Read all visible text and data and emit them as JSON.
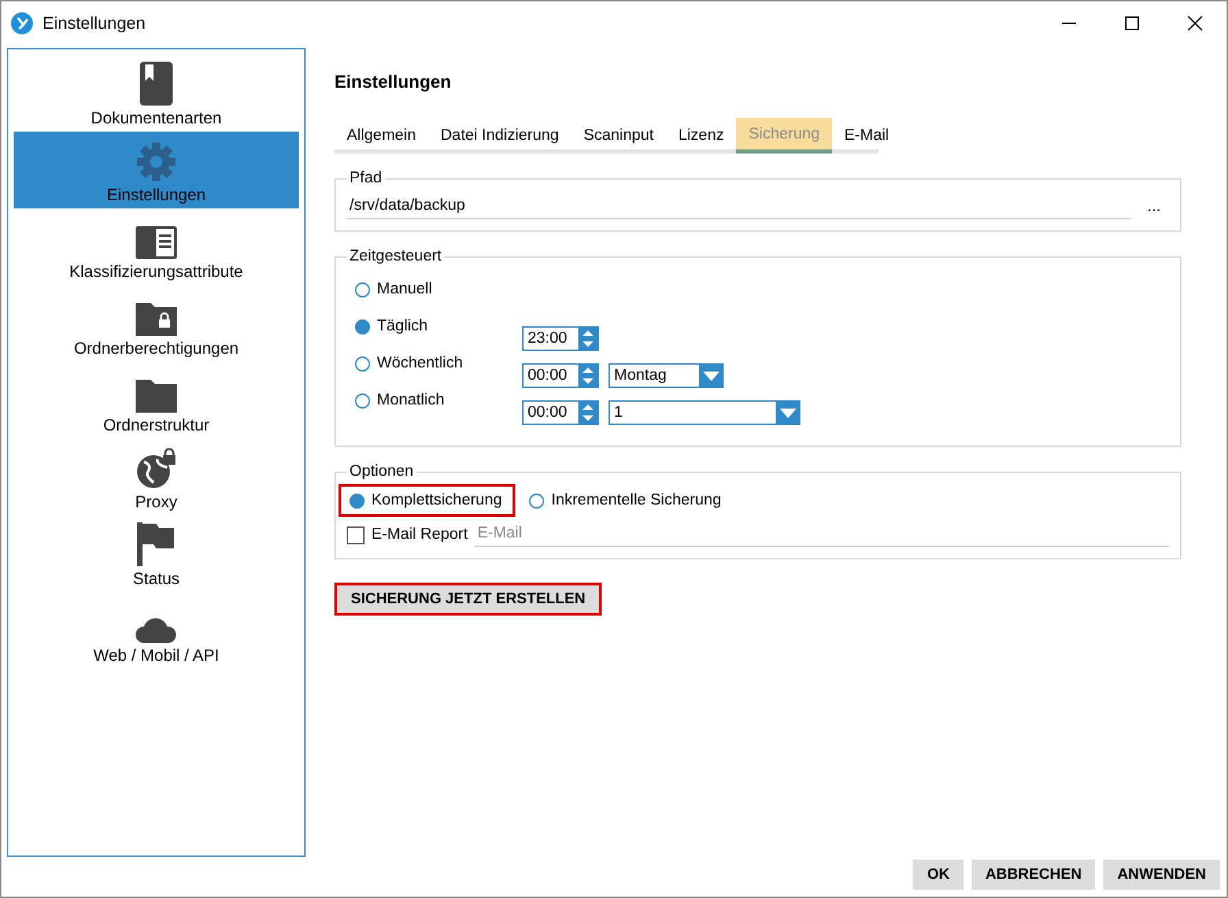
{
  "window": {
    "title": "Einstellungen"
  },
  "sidebar": {
    "items": [
      {
        "label": "Dokumentenarten",
        "selected": false
      },
      {
        "label": "Einstellungen",
        "selected": true
      },
      {
        "label": "Klassifizierungsattribute",
        "selected": false
      },
      {
        "label": "Ordnerberechtigungen",
        "selected": false
      },
      {
        "label": "Ordnerstruktur",
        "selected": false
      },
      {
        "label": "Proxy",
        "selected": false
      },
      {
        "label": "Status",
        "selected": false
      },
      {
        "label": "Web / Mobil / API",
        "selected": false
      }
    ]
  },
  "heading": "Einstellungen",
  "tabs": [
    {
      "label": "Allgemein",
      "selected": false
    },
    {
      "label": "Datei Indizierung",
      "selected": false
    },
    {
      "label": "Scaninput",
      "selected": false
    },
    {
      "label": "Lizenz",
      "selected": false
    },
    {
      "label": "Sicherung",
      "selected": true
    },
    {
      "label": "E-Mail",
      "selected": false
    }
  ],
  "path_group": {
    "legend": "Pfad",
    "value": "/srv/data/backup",
    "browse_button": "..."
  },
  "schedule_group": {
    "legend": "Zeitgesteuert",
    "options": [
      {
        "kind": "plain",
        "label": "Manuell",
        "selected": false
      },
      {
        "kind": "time",
        "label": "Täglich",
        "selected": true,
        "time": "23:00"
      },
      {
        "kind": "weekday",
        "label": "Wöchentlich",
        "selected": false,
        "time": "00:00",
        "dropdown": "Montag"
      },
      {
        "kind": "monthday",
        "label": "Monatlich",
        "selected": false,
        "time": "00:00",
        "dropdown": "1"
      }
    ]
  },
  "options_group": {
    "legend": "Optionen",
    "modes": [
      {
        "label": "Komplettsicherung",
        "selected": true,
        "highlighted": true
      },
      {
        "label": "Inkrementelle Sicherung",
        "selected": false,
        "highlighted": false
      }
    ],
    "email_report": {
      "label": "E-Mail Report",
      "checked": false,
      "placeholder": "E-Mail"
    }
  },
  "action_button": {
    "label": "SICHERUNG JETZT ERSTELLEN",
    "highlighted": true
  },
  "buttons": [
    "OK",
    "ABBRECHEN",
    "ANWENDEN"
  ]
}
